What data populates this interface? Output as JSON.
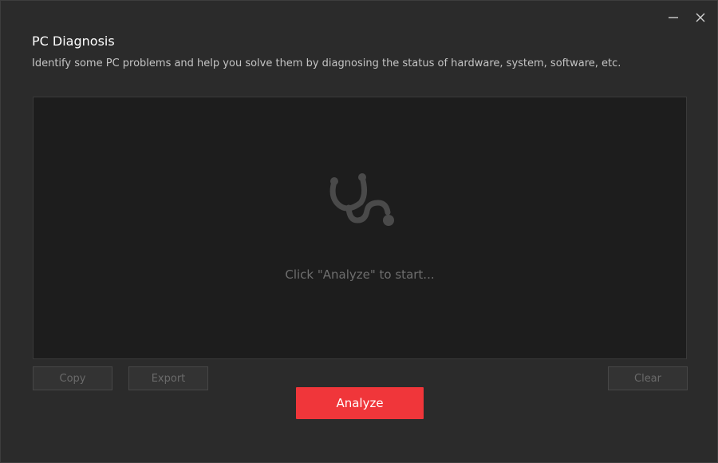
{
  "window": {
    "minimize_icon": "minimize-icon",
    "close_icon": "close-icon"
  },
  "header": {
    "title": "PC Diagnosis",
    "subtitle": "Identify some PC problems and help you solve them by diagnosing the status of hardware, system, software, etc."
  },
  "result_panel": {
    "icon": "stethoscope-icon",
    "hint": "Click \"Analyze\" to start..."
  },
  "actions": {
    "copy_label": "Copy",
    "export_label": "Export",
    "clear_label": "Clear",
    "analyze_label": "Analyze"
  },
  "colors": {
    "background": "#2b2b2b",
    "panel": "#1d1d1d",
    "accent": "#f0363a",
    "disabled_text": "#6a6a6a"
  }
}
